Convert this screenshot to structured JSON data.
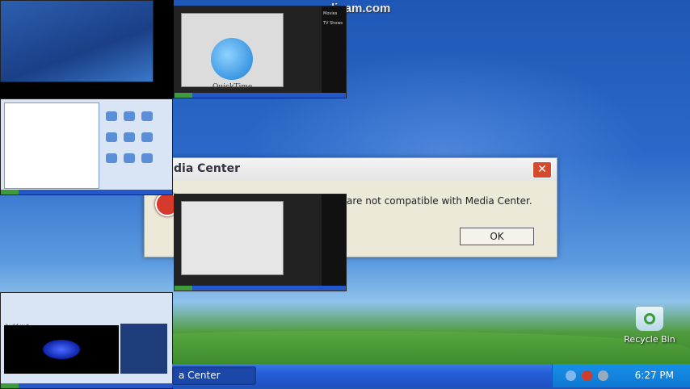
{
  "watermark": "dicam.com",
  "dialog": {
    "title": "dia Center",
    "message": "are not compatible with Media Center.",
    "ok_label": "OK",
    "close_label": "✕"
  },
  "thumbnails": {
    "quicktime": {
      "logo_text": "QuickTime",
      "side_labels": [
        "Movies",
        "TV Shows"
      ]
    },
    "media_player": {
      "label": "buddyout"
    }
  },
  "desktop": {
    "recycle_bin_label": "Recycle Bin"
  },
  "taskbar": {
    "task_label": "a Center",
    "clock": "6:27 PM"
  },
  "colors": {
    "taskbar_blue": "#245ed8",
    "tray_blue": "#0e78d2",
    "close_red": "#d54a2c"
  }
}
